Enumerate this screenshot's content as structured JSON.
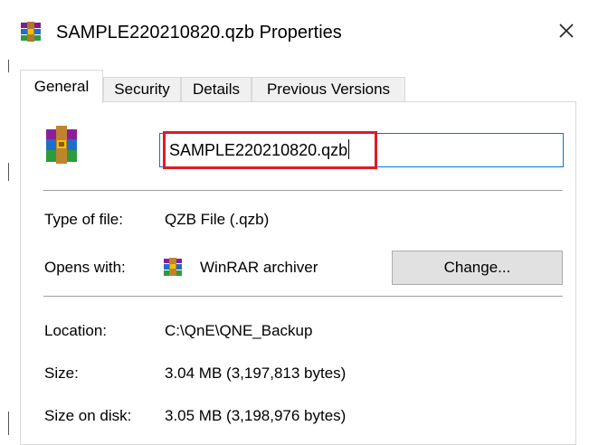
{
  "window": {
    "title": "SAMPLE220210820.qzb Properties",
    "title_icon": "winrar-archive-icon",
    "close_icon": "close-icon"
  },
  "tabs": [
    {
      "label": "General",
      "active": true
    },
    {
      "label": "Security",
      "active": false
    },
    {
      "label": "Details",
      "active": false
    },
    {
      "label": "Previous Versions",
      "active": false
    }
  ],
  "general": {
    "file_icon": "winrar-archive-icon",
    "file_name": "SAMPLE220210820.qzb",
    "type_label": "Type of file:",
    "type_value": "QZB File (.qzb)",
    "opens_label": "Opens with:",
    "opens_icon": "winrar-icon",
    "opens_value": "WinRAR archiver",
    "change_button": "Change...",
    "location_label": "Location:",
    "location_value": "C:\\QnE\\QNE_Backup",
    "size_label": "Size:",
    "size_value": "3.04 MB (3,197,813 bytes)",
    "size_on_disk_label": "Size on disk:",
    "size_on_disk_value": "3.05 MB (3,198,976 bytes)"
  },
  "colors": {
    "focus_border": "#0078d7",
    "highlight": "#e01b24",
    "button_bg": "#e1e1e1"
  }
}
